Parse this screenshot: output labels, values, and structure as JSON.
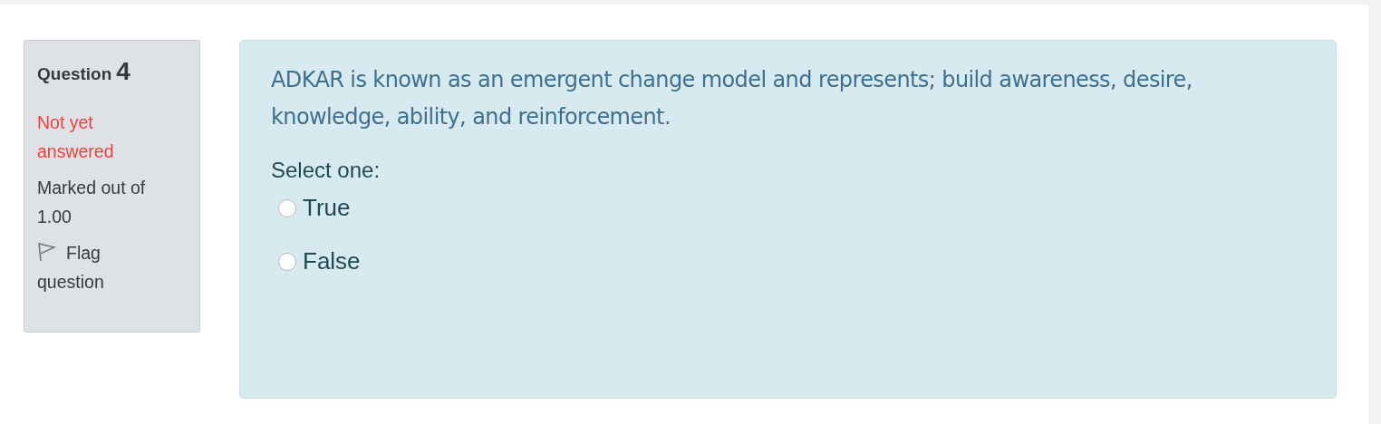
{
  "info": {
    "label": "Question",
    "number": "4",
    "status": "Not yet answered",
    "marks": "Marked out of 1.00",
    "flag": {
      "label": "Flag question"
    }
  },
  "content": {
    "question": "ADKAR is known as an emergent change model and represents; build awareness, desire, knowledge, ability, and reinforcement.",
    "prompt": "Select one:",
    "options": [
      {
        "label": "True",
        "selected": false
      },
      {
        "label": "False",
        "selected": false
      }
    ]
  }
}
